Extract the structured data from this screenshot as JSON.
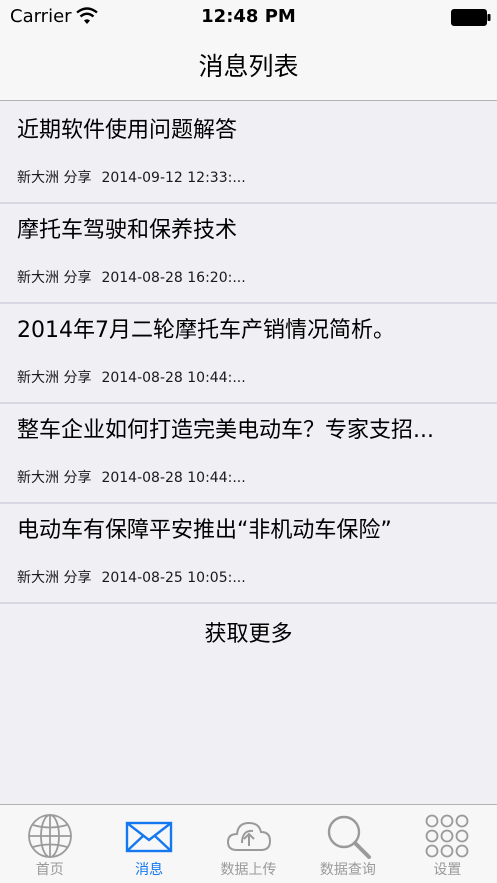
{
  "status_bar": {
    "carrier": "Carrier",
    "time": "12:48 PM"
  },
  "nav": {
    "title": "消息列表"
  },
  "messages": [
    {
      "title": "近期软件使用问题解答",
      "author": "新大洲 分享",
      "date": "2014-09-12 12:33:..."
    },
    {
      "title": "摩托车驾驶和保养技术",
      "author": "新大洲 分享",
      "date": "2014-08-28 16:20:..."
    },
    {
      "title": "2014年7月二轮摩托车产销情况简析。",
      "author": "新大洲 分享",
      "date": "2014-08-28 10:44:..."
    },
    {
      "title": "整车企业如何打造完美电动车？专家支招...",
      "author": "新大洲 分享",
      "date": "2014-08-28 10:44:..."
    },
    {
      "title": "电动车有保障平安推出“非机动车保险”",
      "author": "新大洲 分享",
      "date": "2014-08-25 10:05:..."
    }
  ],
  "load_more": "获取更多",
  "tabs": [
    {
      "label": "首页",
      "icon": "globe-icon"
    },
    {
      "label": "消息",
      "icon": "envelope-icon",
      "active": true
    },
    {
      "label": "数据上传",
      "icon": "cloud-upload-icon"
    },
    {
      "label": "数据查询",
      "icon": "magnifier-icon"
    },
    {
      "label": "设置",
      "icon": "grid-dots-icon"
    }
  ],
  "colors": {
    "accent": "#1478f0",
    "tab_inactive": "#9a9a9a",
    "background": "#efeff4"
  }
}
